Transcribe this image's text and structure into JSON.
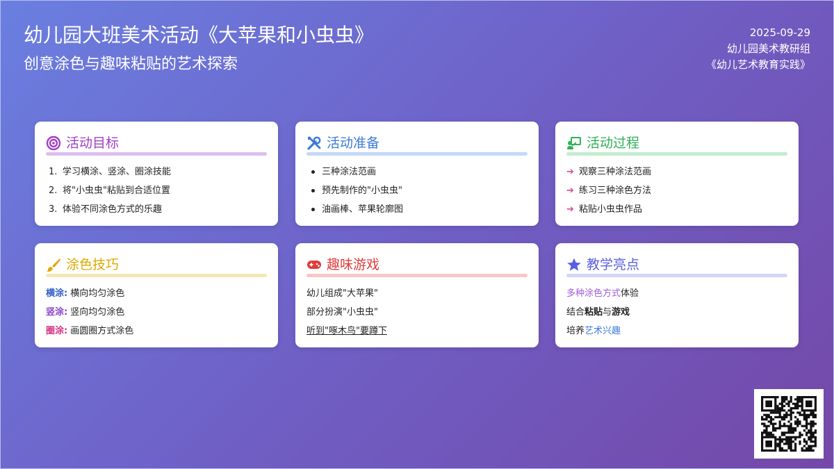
{
  "header": {
    "title": "幼儿园大班美术活动《大苹果和小虫虫》",
    "subtitle": "创意涂色与趣味粘贴的艺术探索",
    "date": "2025-09-29",
    "author": "幼儿园美术教研组",
    "source": "《幼儿艺术教育实践》"
  },
  "cards": {
    "goal": {
      "title": "活动目标",
      "icon": "target-icon",
      "color": "#a03fc8",
      "bar": "#ddbff0",
      "items": [
        "学习横涂、竖涂、圈涂技能",
        "将\"小虫虫\"粘贴到合适位置",
        "体验不同涂色方式的乐趣"
      ],
      "numbers": [
        "1.",
        "2.",
        "3."
      ]
    },
    "prep": {
      "title": "活动准备",
      "icon": "tools-icon",
      "color": "#3b7ad8",
      "bar": "#c5d8f5",
      "items": [
        "三种涂法范画",
        "预先制作的\"小虫虫\"",
        "油画棒、苹果轮廓图"
      ]
    },
    "process": {
      "title": "活动过程",
      "icon": "teacher-board-icon",
      "color": "#2fb157",
      "bar": "#c4ecd0",
      "items": [
        "观察三种涂法范画",
        "练习三种涂色方法",
        "粘贴小虫虫作品"
      ]
    },
    "skills": {
      "title": "涂色技巧",
      "icon": "paint-brush-icon",
      "color": "#e0a800",
      "bar": "#f6e6b3",
      "items": [
        {
          "label": "横涂:",
          "text": "横向均匀涂色",
          "color": "#2f5fc8"
        },
        {
          "label": "竖涂:",
          "text": "竖向均匀涂色",
          "color": "#8a3fc8"
        },
        {
          "label": "圈涂:",
          "text": "画圆圈方式涂色",
          "color": "#d63384"
        }
      ]
    },
    "game": {
      "title": "趣味游戏",
      "icon": "gamepad-icon",
      "color": "#e03b3b",
      "bar": "#f7c7c7",
      "items": [
        "幼儿组成\"大苹果\"",
        "部分扮演\"小虫虫\"",
        "听到\"啄木鸟\"要蹲下"
      ]
    },
    "highlight": {
      "title": "教学亮点",
      "icon": "star-icon",
      "color": "#5a5ee0",
      "bar": "#d4d6f7",
      "row1": {
        "a": "多种涂色方式",
        "b": "体验"
      },
      "row2": {
        "a": "结合",
        "b": "粘贴",
        "c": "与",
        "d": "游戏"
      },
      "row3": {
        "a": "培养",
        "b": "艺术兴趣"
      },
      "accent_purple": "#a05ad8",
      "accent_blue": "#3b7ad8"
    }
  }
}
